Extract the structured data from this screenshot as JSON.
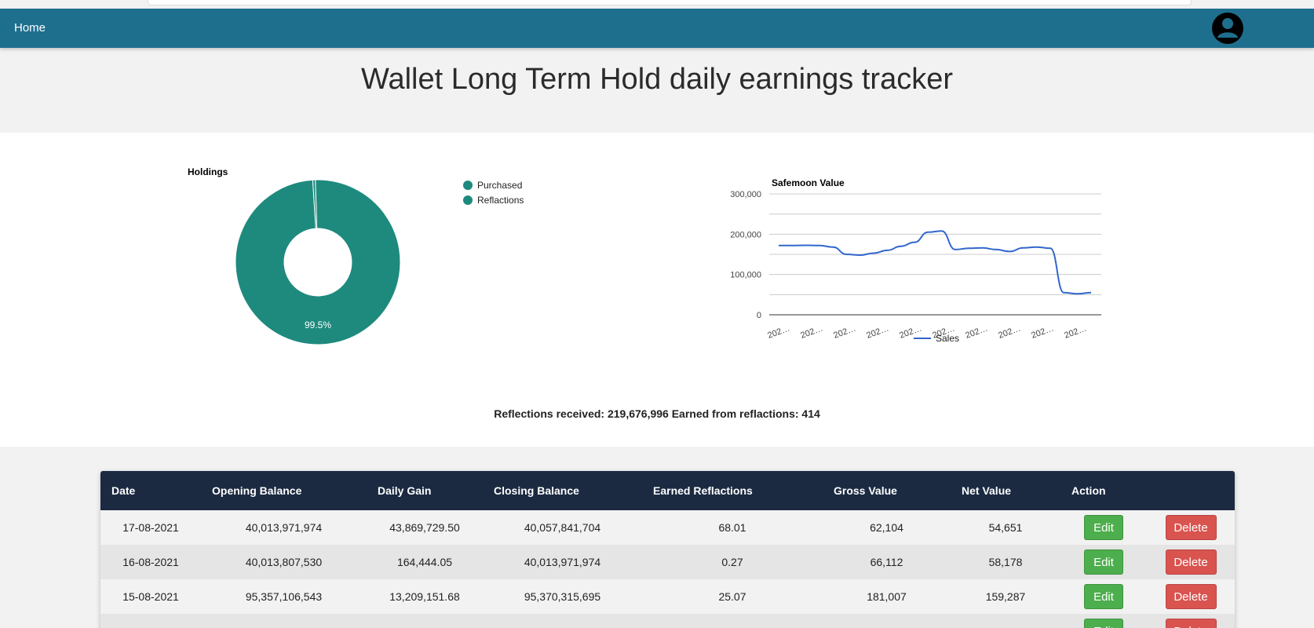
{
  "nav": {
    "home": "Home"
  },
  "page_title": "Wallet Long Term Hold daily earnings tracker",
  "holdings_chart": {
    "title": "Holdings",
    "legend": [
      "Purchased",
      "Reflactions"
    ],
    "slice_label": "99.5%"
  },
  "value_chart": {
    "title": "Safemoon Value",
    "legend": "Sales",
    "y_ticks": [
      "300,000",
      "200,000",
      "100,000",
      "0"
    ],
    "x_tick": "202…"
  },
  "summary": "Reflections received: 219,676,996 Earned from reflactions: 414",
  "table": {
    "headers": [
      "Date",
      "Opening Balance",
      "Daily Gain",
      "Closing Balance",
      "Earned Reflactions",
      "Gross Value",
      "Net Value",
      "Action",
      ""
    ],
    "edit_label": "Edit",
    "delete_label": "Delete",
    "rows": [
      [
        "17-08-2021",
        "40,013,971,974",
        "43,869,729.50",
        "40,057,841,704",
        "68.01",
        "62,104",
        "54,651"
      ],
      [
        "16-08-2021",
        "40,013,807,530",
        "164,444.05",
        "40,013,971,974",
        "0.27",
        "66,112",
        "58,178"
      ],
      [
        "15-08-2021",
        "95,357,106,543",
        "13,209,151.68",
        "95,370,315,695",
        "25.07",
        "181,007",
        "159,287"
      ]
    ]
  },
  "chart_data": [
    {
      "type": "pie",
      "title": "Holdings",
      "categories": [
        "Purchased",
        "Reflactions"
      ],
      "values": [
        99.5,
        0.5
      ],
      "donut": true,
      "colors": [
        "#1e8a7e",
        "#1e8a7e"
      ]
    },
    {
      "type": "line",
      "title": "Safemoon Value",
      "series": [
        {
          "name": "Sales",
          "values": [
            172000,
            172000,
            172500,
            172000,
            168000,
            150000,
            148000,
            153000,
            160000,
            170000,
            180000,
            205000,
            208000,
            162000,
            165000,
            166000,
            162000,
            157000,
            166000,
            168000,
            165000,
            55000,
            52000,
            55000
          ]
        }
      ],
      "ylim": [
        0,
        300000
      ],
      "grid": true,
      "legend_position": "bottom",
      "color": "#3366cc"
    }
  ]
}
